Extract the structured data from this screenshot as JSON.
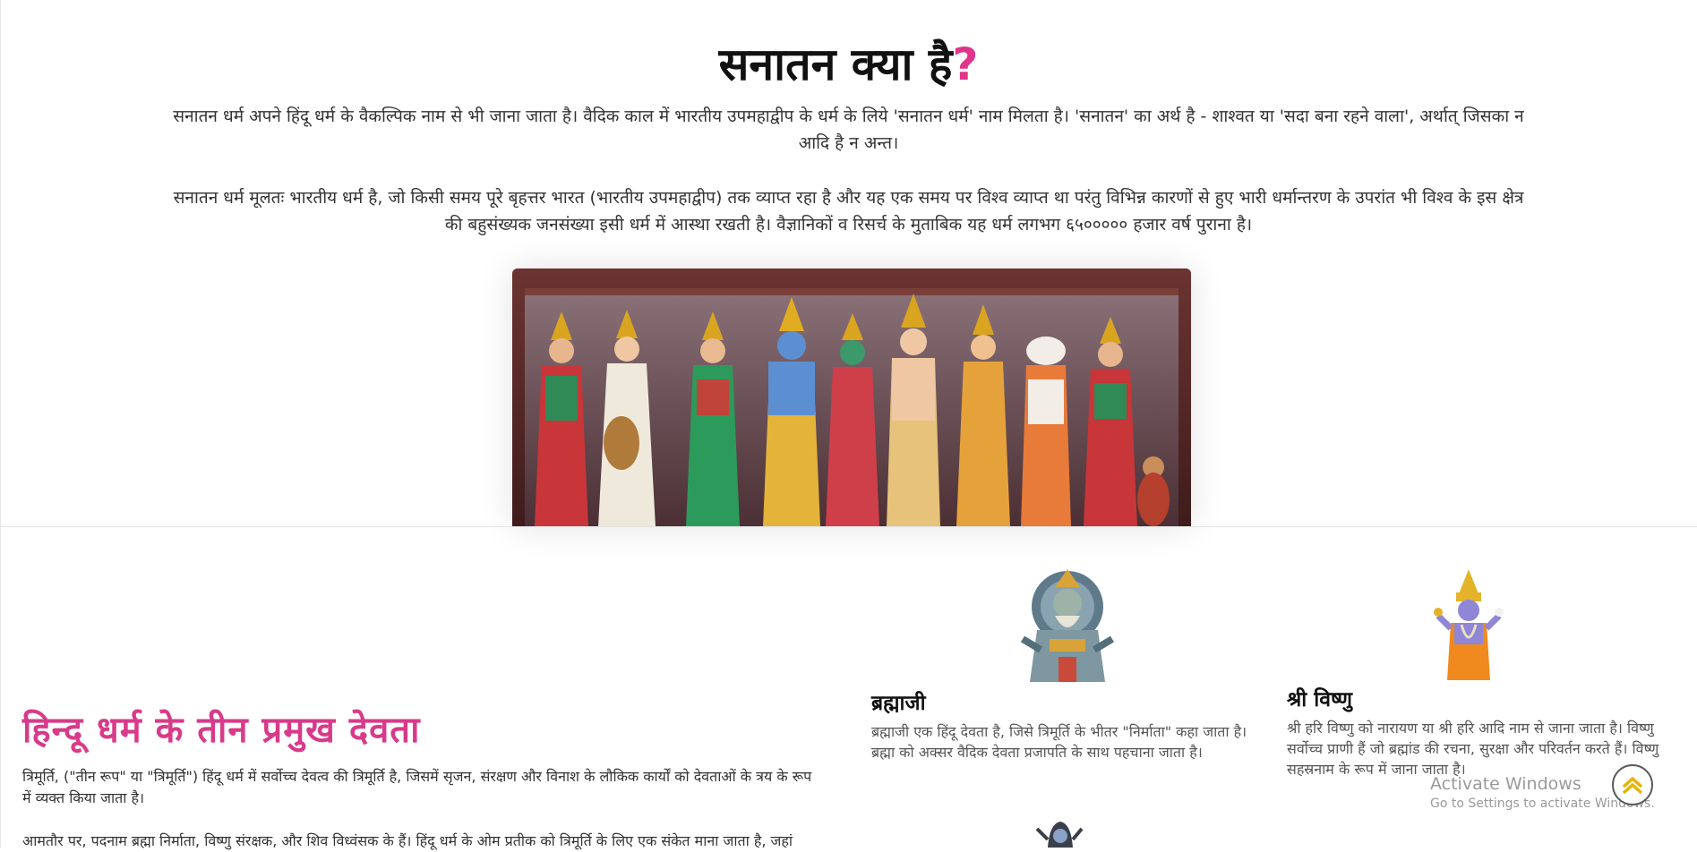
{
  "top": {
    "title_main": "सनातन क्या है",
    "title_mark": "?",
    "paragraph1": "सनातन धर्म अपने हिंदू धर्म के वैकल्पिक नाम से भी जाना जाता है। वैदिक काल में भारतीय उपमहाद्वीप के धर्म के लिये 'सनातन धर्म' नाम मिलता है। 'सनातन' का अर्थ है - शाश्वत या 'सदा बना रहने वाला', अर्थात् जिसका न आदि है न अन्त।",
    "paragraph2": "सनातन धर्म मूलतः भारतीय धर्म है, जो किसी समय पूरे बृहत्तर भारत (भारतीय उपमहाद्वीप) तक व्याप्त रहा है और यह एक समय पर विश्व व्याप्त था परंतु विभिन्न कारणों से हुए भारी धर्मान्तरण के उपरांत भी विश्व के इस क्षेत्र की बहुसंख्यक जनसंख्या इसी धर्म में आस्था रखती है। वैज्ञानिकों व रिसर्च के मुताबिक यह धर्म लगभग ६५००००० हजार वर्ष पुराना है।"
  },
  "deities": {
    "heading": "हिन्दू धर्म के तीन प्रमुख देवता",
    "text1": "त्रिमूर्ति, (\"तीन रूप\" या \"त्रिमूर्ति\") हिंदू धर्म में सर्वोच्च देवत्व की त्रिमूर्ति है, जिसमें सृजन, संरक्षण और विनाश के लौकिक कार्यों को देवताओं के त्रय के रूप में व्यक्त किया जाता है।",
    "text2": "आमतौर पर, पदनाम ब्रह्मा निर्माता, विष्णु संरक्षक, और शिव विध्वंसक के हैं। हिंदू धर्म के ओम प्रतीक को त्रिमूर्ति के लिए एक संकेत माना जाता है, जहां",
    "cards": [
      {
        "name": "ब्रह्माजी",
        "description": "ब्रह्माजी एक हिंदू देवता है, जिसे त्रिमूर्ति के भीतर \"निर्माता\" कहा जाता है। ब्रह्मा को अक्सर वैदिक देवता प्रजापति के साथ पहचाना जाता है।"
      },
      {
        "name": "श्री विष्णु",
        "description": "श्री हरि विष्णु को नारायण या श्री हरि आदि नाम से जाना जाता है। विष्णु सर्वोच्च प्राणी हैं जो ब्रह्मांड की रचना, सुरक्षा और परिवर्तन करते हैं। विष्णु सहस्रनाम के रूप में जाना जाता है।"
      }
    ]
  },
  "watermark": {
    "title": "Activate Windows",
    "subtitle": "Go to Settings to activate Windows."
  },
  "colors": {
    "accent": "#e0358b",
    "heading_pink": "#d83a8a",
    "scroll_chevron": "#e8b400"
  },
  "icons": {
    "scroll_to_top": "chevron-up-icon"
  }
}
